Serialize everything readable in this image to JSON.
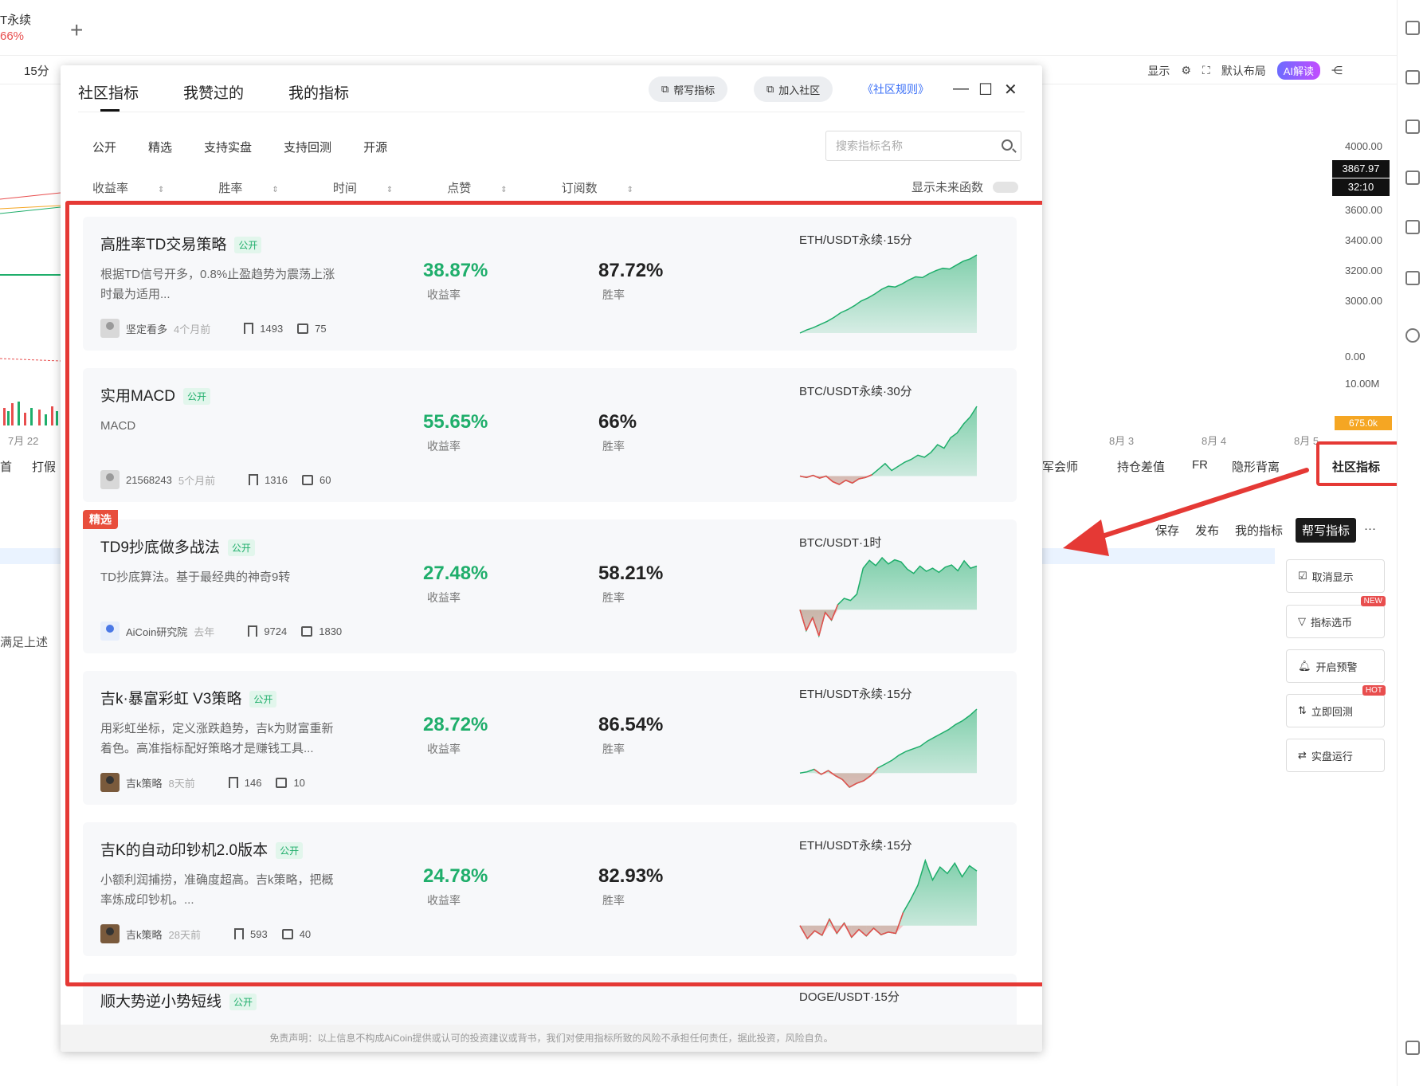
{
  "background": {
    "tab_title": "T永续",
    "tab_change": "66%",
    "toolbar_left": "15分",
    "toolbar_right": [
      "显示",
      "默认布局",
      "AI解读"
    ],
    "price_levels": [
      "4000.00",
      "3867.97",
      "32:10",
      "3600.00",
      "3400.00",
      "3200.00",
      "3000.00",
      "0.00",
      "10.00M",
      "675.0k"
    ],
    "dates": [
      "7月 22",
      "8月 3",
      "8月 4",
      "8月 5"
    ],
    "bottom_tabs": [
      "首",
      "打假",
      "军会师",
      "持仓差值",
      "FR",
      "隐形背离",
      "社区指标"
    ],
    "actions": [
      "保存",
      "发布",
      "我的指标",
      "帮写指标"
    ],
    "left_text": "满足上述",
    "side_buttons": [
      {
        "label": "取消显示",
        "badge": ""
      },
      {
        "label": "指标选币",
        "badge": "NEW"
      },
      {
        "label": "开启预警",
        "badge": ""
      },
      {
        "label": "立即回测",
        "badge": "HOT"
      },
      {
        "label": "实盘运行",
        "badge": ""
      }
    ]
  },
  "modal": {
    "tabs": [
      "社区指标",
      "我赞过的",
      "我的指标"
    ],
    "help_button": "帮写指标",
    "join_button": "加入社区",
    "rules_link": "《社区规则》",
    "filters": [
      "公开",
      "精选",
      "支持实盘",
      "支持回测",
      "开源"
    ],
    "search_placeholder": "搜索指标名称",
    "sorts": [
      "收益率",
      "胜率",
      "时间",
      "点赞",
      "订阅数"
    ],
    "future_toggle_label": "显示未来函数",
    "public_badge": "公开",
    "return_label": "收益率",
    "winrate_label": "胜率",
    "featured_label": "精选",
    "cards": [
      {
        "title": "高胜率TD交易策略",
        "desc": "根据TD信号开多，0.8%止盈趋势为震荡上涨时最为适用...",
        "author": "坚定看多",
        "time": "4个月前",
        "bookmarks": "1493",
        "likes": "75",
        "return": "38.87%",
        "winrate": "87.72%",
        "pair": "ETH/USDT永续·15分",
        "featured": false,
        "curve": [
          0,
          4,
          7,
          11,
          15,
          20,
          26,
          30,
          35,
          41,
          45,
          50,
          56,
          60,
          59,
          63,
          68,
          72,
          71,
          76,
          80,
          83,
          82,
          87,
          92,
          95,
          100
        ]
      },
      {
        "title": "实用MACD",
        "desc": "MACD",
        "author": "21568243",
        "time": "5个月前",
        "bookmarks": "1316",
        "likes": "60",
        "return": "55.65%",
        "winrate": "66%",
        "pair": "BTC/USDT永续·30分",
        "featured": false,
        "curve": [
          0,
          -2,
          1,
          -3,
          0,
          -8,
          -12,
          -6,
          -10,
          -4,
          -2,
          2,
          10,
          18,
          8,
          14,
          20,
          24,
          30,
          27,
          34,
          45,
          40,
          55,
          62,
          75,
          85,
          100
        ]
      },
      {
        "title": "TD9抄底做多战法",
        "desc": "TD抄底算法。基于最经典的神奇9转",
        "author": "AiCoin研究院",
        "time": "去年",
        "bookmarks": "9724",
        "likes": "1830",
        "return": "27.48%",
        "winrate": "58.21%",
        "pair": "BTC/USDT·1时",
        "featured": true,
        "curve": [
          0,
          -40,
          -15,
          -50,
          -5,
          -20,
          10,
          22,
          18,
          30,
          80,
          95,
          85,
          100,
          88,
          96,
          92,
          78,
          70,
          84,
          74,
          80,
          72,
          82,
          86,
          75,
          94,
          80,
          84
        ]
      },
      {
        "title": "吉k·暴富彩虹 V3策略",
        "desc": "用彩虹坐标，定义涨跌趋势，吉k为财富重新着色。高准指标配好策略才是赚钱工具...",
        "author": "吉k策略",
        "time": "8天前",
        "bookmarks": "146",
        "likes": "10",
        "return": "28.72%",
        "winrate": "86.54%",
        "pair": "ETH/USDT永续·15分",
        "featured": false,
        "curve": [
          0,
          2,
          6,
          -2,
          4,
          -4,
          -10,
          -22,
          -16,
          -12,
          -4,
          8,
          14,
          20,
          28,
          34,
          38,
          42,
          50,
          56,
          62,
          68,
          76,
          82,
          90,
          100
        ]
      },
      {
        "title": "吉K的自动印钞机2.0版本",
        "desc": "小额利润捕捞，准确度超高。吉k策略，把概率炼成印钞机。...",
        "author": "吉k策略",
        "time": "28天前",
        "bookmarks": "593",
        "likes": "40",
        "return": "24.78%",
        "winrate": "82.93%",
        "pair": "ETH/USDT永续·15分",
        "featured": false,
        "curve": [
          0,
          -20,
          -8,
          -15,
          10,
          -12,
          4,
          -18,
          -6,
          -16,
          -4,
          -14,
          -10,
          -12,
          20,
          40,
          62,
          100,
          70,
          90,
          80,
          96,
          75,
          92,
          84
        ]
      },
      {
        "title": "顺大势逆小势短线",
        "desc": "",
        "author": "",
        "time": "",
        "bookmarks": "",
        "likes": "",
        "return": "",
        "winrate": "",
        "pair": "DOGE/USDT·15分",
        "featured": false,
        "curve": []
      }
    ],
    "disclaimer": "免责声明：以上信息不构成AiCoin提供或认可的投资建议或背书，我们对使用指标所致的风险不承担任何责任，据此投资，风险自负。"
  },
  "colors": {
    "up": "#1fae6b",
    "down": "#e84e4e",
    "highlight": "#e53935",
    "link": "#3a6ff7"
  }
}
